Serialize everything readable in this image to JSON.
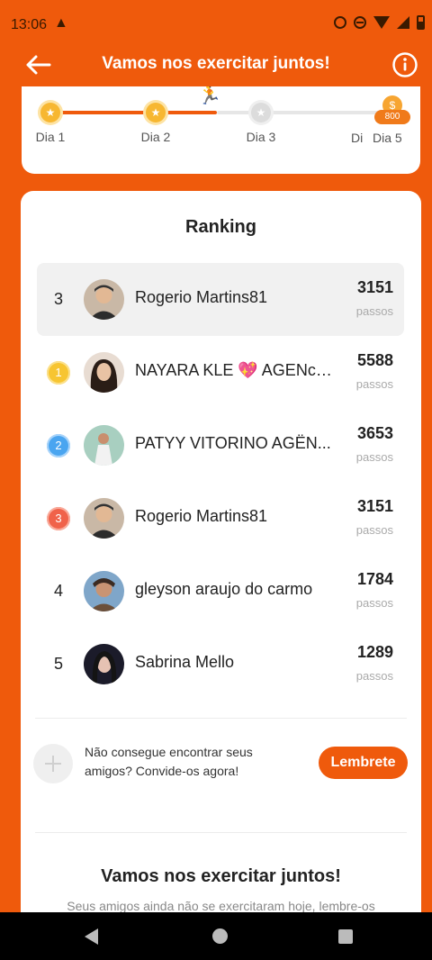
{
  "status_bar": {
    "time": "13:06",
    "warning_icon": "warning-icon"
  },
  "header": {
    "title": "Vamos nos exercitar juntos!",
    "back_icon": "back-arrow-icon",
    "info_icon": "info-icon"
  },
  "progress": {
    "days": [
      {
        "label": "Dia 1",
        "state": "done"
      },
      {
        "label": "Dia 2",
        "state": "done"
      },
      {
        "label": "Dia 3",
        "state": "todo"
      },
      {
        "label": "Dia 5",
        "state": "reward"
      }
    ],
    "reward_points": "800",
    "partial_label": "Di"
  },
  "ranking": {
    "title": "Ranking",
    "unit": "passos",
    "me": {
      "position": "3",
      "name": "Rogerio Martins81",
      "steps": "3151"
    },
    "rows": [
      {
        "position": "1",
        "medal": "gold",
        "name": "NAYARA KLE 💖 AGENcIA ...",
        "steps": "5588"
      },
      {
        "position": "2",
        "medal": "silver",
        "name": "PATYY VITORINO AGËN...",
        "steps": "3653"
      },
      {
        "position": "3",
        "medal": "bronze",
        "name": "Rogerio Martins81",
        "steps": "3151"
      },
      {
        "position": "4",
        "medal": "",
        "name": "gleyson araujo do carmo",
        "steps": "1784"
      },
      {
        "position": "5",
        "medal": "",
        "name": "Sabrina Mello",
        "steps": "1289"
      }
    ]
  },
  "invite": {
    "text": "Não consegue encontrar seus amigos? Convide-os agora!",
    "button": "Lembrete"
  },
  "bottom": {
    "title": "Vamos nos exercitar juntos!",
    "subtitle": "Seus amigos ainda não se exercitaram hoje, lembre-os"
  },
  "colors": {
    "accent": "#ef5a0c",
    "gold": "#f7c531",
    "silver": "#4aa5f0",
    "bronze": "#f0624a"
  }
}
